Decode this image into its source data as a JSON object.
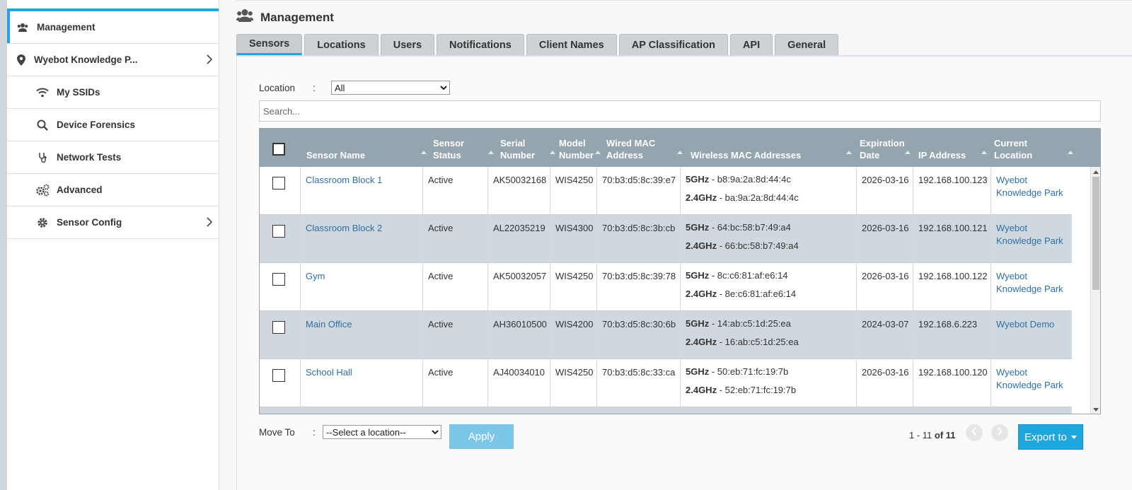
{
  "sidebar": {
    "items": [
      {
        "label": "Management",
        "icon": "users-icon"
      },
      {
        "label": "Wyebot Knowledge P...",
        "icon": "location-pin-icon"
      },
      {
        "label": "My SSIDs",
        "icon": "wifi-icon"
      },
      {
        "label": "Device Forensics",
        "icon": "search-icon"
      },
      {
        "label": "Network Tests",
        "icon": "stethoscope-icon"
      },
      {
        "label": "Advanced",
        "icon": "gears-icon"
      },
      {
        "label": "Sensor Config",
        "icon": "gear-icon"
      }
    ]
  },
  "header": {
    "title": "Management",
    "icon": "users-icon"
  },
  "tabs": [
    "Sensors",
    "Locations",
    "Users",
    "Notifications",
    "Client Names",
    "AP Classification",
    "API",
    "General"
  ],
  "filter": {
    "label": "Location",
    "colon": ":",
    "selected": "All"
  },
  "search": {
    "placeholder": "Search..."
  },
  "table": {
    "headers": {
      "name": "Sensor Name",
      "status_1": "Sensor",
      "status_2": "Status",
      "serial_1": "Serial",
      "serial_2": "Number",
      "model_1": "Model",
      "model_2": "Number",
      "wired_1": "Wired MAC",
      "wired_2": "Address",
      "wireless": "Wireless MAC Addresses",
      "exp_1": "Expiration",
      "exp_2": "Date",
      "ip": "IP Address",
      "loc_1": "Current",
      "loc_2": "Location"
    },
    "rows": [
      {
        "name": "Classroom Block 1",
        "status": "Active",
        "serial": "AK50032168",
        "model": "WIS4250",
        "wired": "70:b3:d5:8c:39:e7",
        "band1": "5GHz",
        "mac1": " - b8:9a:2a:8d:44:4c",
        "band2": "2.4GHz",
        "mac2": " - ba:9a:2a:8d:44:4c",
        "exp": "2026-03-16",
        "ip": "192.168.100.123",
        "loc1": "Wyebot",
        "loc2": "Knowledge Park"
      },
      {
        "name": "Classroom Block 2",
        "status": "Active",
        "serial": "AL22035219",
        "model": "WIS4300",
        "wired": "70:b3:d5:8c:3b:cb",
        "band1": "5GHz",
        "mac1": " - 64:bc:58:b7:49:a4",
        "band2": "2.4GHz",
        "mac2": " - 66:bc:58:b7:49:a4",
        "exp": "2026-03-16",
        "ip": "192.168.100.121",
        "loc1": "Wyebot",
        "loc2": "Knowledge Park"
      },
      {
        "name": "Gym",
        "status": "Active",
        "serial": "AK50032057",
        "model": "WIS4250",
        "wired": "70:b3:d5:8c:39:78",
        "band1": "5GHz",
        "mac1": " - 8c:c6:81:af:e6:14",
        "band2": "2.4GHz",
        "mac2": " - 8e:c6:81:af:e6:14",
        "exp": "2026-03-16",
        "ip": "192.168.100.122",
        "loc1": "Wyebot",
        "loc2": "Knowledge Park"
      },
      {
        "name": "Main Office",
        "status": "Active",
        "serial": "AH36010500",
        "model": "WIS4200",
        "wired": "70:b3:d5:8c:30:6b",
        "band1": "5GHz",
        "mac1": " - 14:ab:c5:1d:25:ea",
        "band2": "2.4GHz",
        "mac2": " - 16:ab:c5:1d:25:ea",
        "exp": "2024-03-07",
        "ip": "192.168.6.223",
        "loc1": "Wyebot Demo",
        "loc2": ""
      },
      {
        "name": "School Hall",
        "status": "Active",
        "serial": "AJ40034010",
        "model": "WIS4250",
        "wired": "70:b3:d5:8c:33:ca",
        "band1": "5GHz",
        "mac1": " - 50:eb:71:fc:19:7b",
        "band2": "2.4GHz",
        "mac2": " - 52:eb:71:fc:19:7b",
        "exp": "2026-03-16",
        "ip": "192.168.100.120",
        "loc1": "Wyebot",
        "loc2": "Knowledge Park"
      }
    ]
  },
  "footer": {
    "move_label": "Move To",
    "colon": ":",
    "move_selected": "--Select a location--",
    "apply": "Apply",
    "pager_range": "1 - 11",
    "pager_of": "of 11",
    "export": "Export to"
  },
  "colors": {
    "accent": "#1ea7de",
    "header_bg": "#95a5b0",
    "link": "#2e6fa7",
    "apply_bg": "#7cc6ea"
  }
}
